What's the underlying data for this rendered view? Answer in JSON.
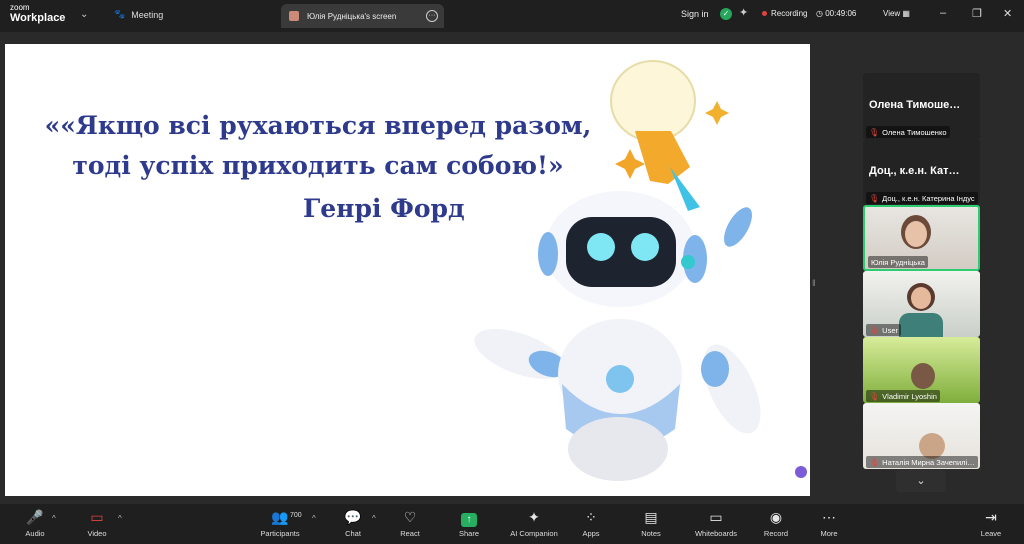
{
  "app": {
    "logo_line1": "zoom",
    "logo_line2": "Workplace",
    "meeting_label": "Meeting"
  },
  "tab": {
    "title": "Юлія Рудніцька's screen"
  },
  "header": {
    "signin": "Sign in",
    "recording": "Recording",
    "timer": "00:49:06",
    "view": "View"
  },
  "slide": {
    "quote_line1": "««Якщо всі рухаються вперед разом,",
    "quote_line2": "тоді успіх приходить сам собою!»",
    "author": "Генрі Форд"
  },
  "participants": [
    {
      "big_name": "Олена  Тимоше…",
      "caption": "Олена Тимошенко",
      "video": false
    },
    {
      "big_name": "Доц., к.е.н. Кат…",
      "caption": "Доц., к.е.н. Катерина Індус",
      "video": false
    },
    {
      "caption": "Юлія Рудніцька",
      "video": true,
      "active": true
    },
    {
      "caption": "User",
      "video": true
    },
    {
      "caption": "Vladimir Lyoshin",
      "video": true
    },
    {
      "caption": "Наталія Мирна Зачепилі…",
      "video": true
    }
  ],
  "toolbar": {
    "audio": "Audio",
    "video": "Video",
    "participants": "Participants",
    "participants_count": "700",
    "chat": "Chat",
    "react": "React",
    "share": "Share",
    "ai": "AI Companion",
    "apps": "Apps",
    "notes": "Notes",
    "whiteboards": "Whiteboards",
    "record": "Record",
    "more": "More",
    "leave": "Leave"
  },
  "colors": {
    "accent_green": "#2ecc71",
    "record_red": "#e0443e",
    "quote_blue": "#2e3a8c"
  }
}
